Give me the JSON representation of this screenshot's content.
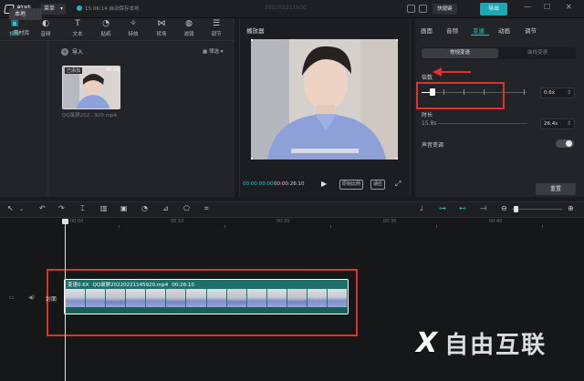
{
  "app": {
    "name": "剪映",
    "menu": "菜单",
    "autosave": "15:06:14 自动保存本地",
    "project_title": "202202211600"
  },
  "header": {
    "shortcut": "快捷键",
    "export": "导出"
  },
  "media_tools": [
    {
      "label": "媒体",
      "icon": "media-icon",
      "glyph": "▣",
      "active": true
    },
    {
      "label": "音频",
      "icon": "audio-icon",
      "glyph": "◐",
      "active": false
    },
    {
      "label": "文本",
      "icon": "text-icon",
      "glyph": "T",
      "active": false
    },
    {
      "label": "贴纸",
      "icon": "sticker-icon",
      "glyph": "◔",
      "active": false
    },
    {
      "label": "特效",
      "icon": "effects-icon",
      "glyph": "✧",
      "active": false
    },
    {
      "label": "转场",
      "icon": "transition-icon",
      "glyph": "⋈",
      "active": false
    },
    {
      "label": "滤镜",
      "icon": "filter-icon",
      "glyph": "◍",
      "active": false
    },
    {
      "label": "调节",
      "icon": "adjust-icon",
      "glyph": "☰",
      "active": false
    }
  ],
  "media_nav": {
    "local": "本地",
    "library": "素材库"
  },
  "media": {
    "import": "导入",
    "sort": "筛选",
    "added_badge": "已添加",
    "duration": "00:16",
    "filename": "QQ录屏202...920.mp4"
  },
  "player": {
    "title": "播放器",
    "current_time": "00:00:00:00",
    "total_time": "00:00:26:10",
    "btn_original": "原始比例",
    "btn_ratio": "适应"
  },
  "inspector": {
    "tabs": [
      {
        "label": "画面",
        "active": false
      },
      {
        "label": "音频",
        "active": false
      },
      {
        "label": "变速",
        "active": true
      },
      {
        "label": "动画",
        "active": false
      },
      {
        "label": "调节",
        "active": false
      }
    ],
    "mode_normal": "常规变速",
    "mode_curve": "曲线变速",
    "speed_label": "倍数",
    "speed_value": "0.6x",
    "duration_label": "时长",
    "duration_from": "15.8s",
    "duration_to": "26.4s",
    "pitch_label": "声音变调",
    "reset": "重置",
    "speed_level": 0.1
  },
  "timeline": {
    "ruler": [
      "00:00",
      "00:10",
      "00:20",
      "00:30",
      "00:40"
    ],
    "cover": "封面",
    "clip": {
      "speed": "变速0.6X",
      "name": "QQ录屏20220221145920.mp4",
      "duration": "00:26:10"
    }
  },
  "watermark": {
    "mark": "X",
    "text": "自由互联"
  },
  "colors": {
    "accent": "#2ec6c0",
    "highlight": "#e0322d",
    "export": "#1aa8b2"
  }
}
